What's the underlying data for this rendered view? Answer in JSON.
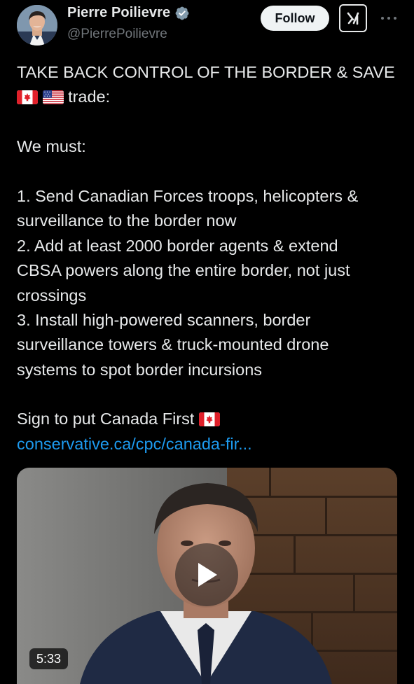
{
  "user": {
    "display_name": "Pierre Poilievre",
    "handle": "@PierrePoilievre",
    "verified": true,
    "avatar_icon": "profile-photo"
  },
  "actions": {
    "follow_label": "Follow",
    "grok_icon": "grok-icon",
    "more_icon": "more-dots-icon"
  },
  "tweet": {
    "line1": "TAKE BACK CONTROL OF THE BORDER & SAVE",
    "line2_flags": [
      "canada-flag-icon",
      "us-flag-icon"
    ],
    "line2_text": "trade:",
    "intro": "We must:",
    "point1_line1": "1. Send Canadian Forces troops, helicopters &",
    "point1_line2": "surveillance to the border now",
    "point2_line1": "2. Add at least 2000 border agents & extend",
    "point2_line2": "CBSA powers along the entire border, not just",
    "point2_line3": "crossings",
    "point3_line1": "3. Install high-powered scanners, border",
    "point3_line2": "surveillance towers & truck-mounted drone",
    "point3_line3": "systems to spot border incursions",
    "cta": "Sign to put Canada First",
    "cta_flag": "canada-flag-icon",
    "link": "conservative.ca/cpc/canada-fir..."
  },
  "video": {
    "duration": "5:33",
    "play_icon": "play-icon"
  },
  "colors": {
    "background": "#000000",
    "text": "#e7e9ea",
    "secondary_text": "#71767b",
    "link": "#1d9bf0",
    "verified_badge": "#829aab"
  }
}
